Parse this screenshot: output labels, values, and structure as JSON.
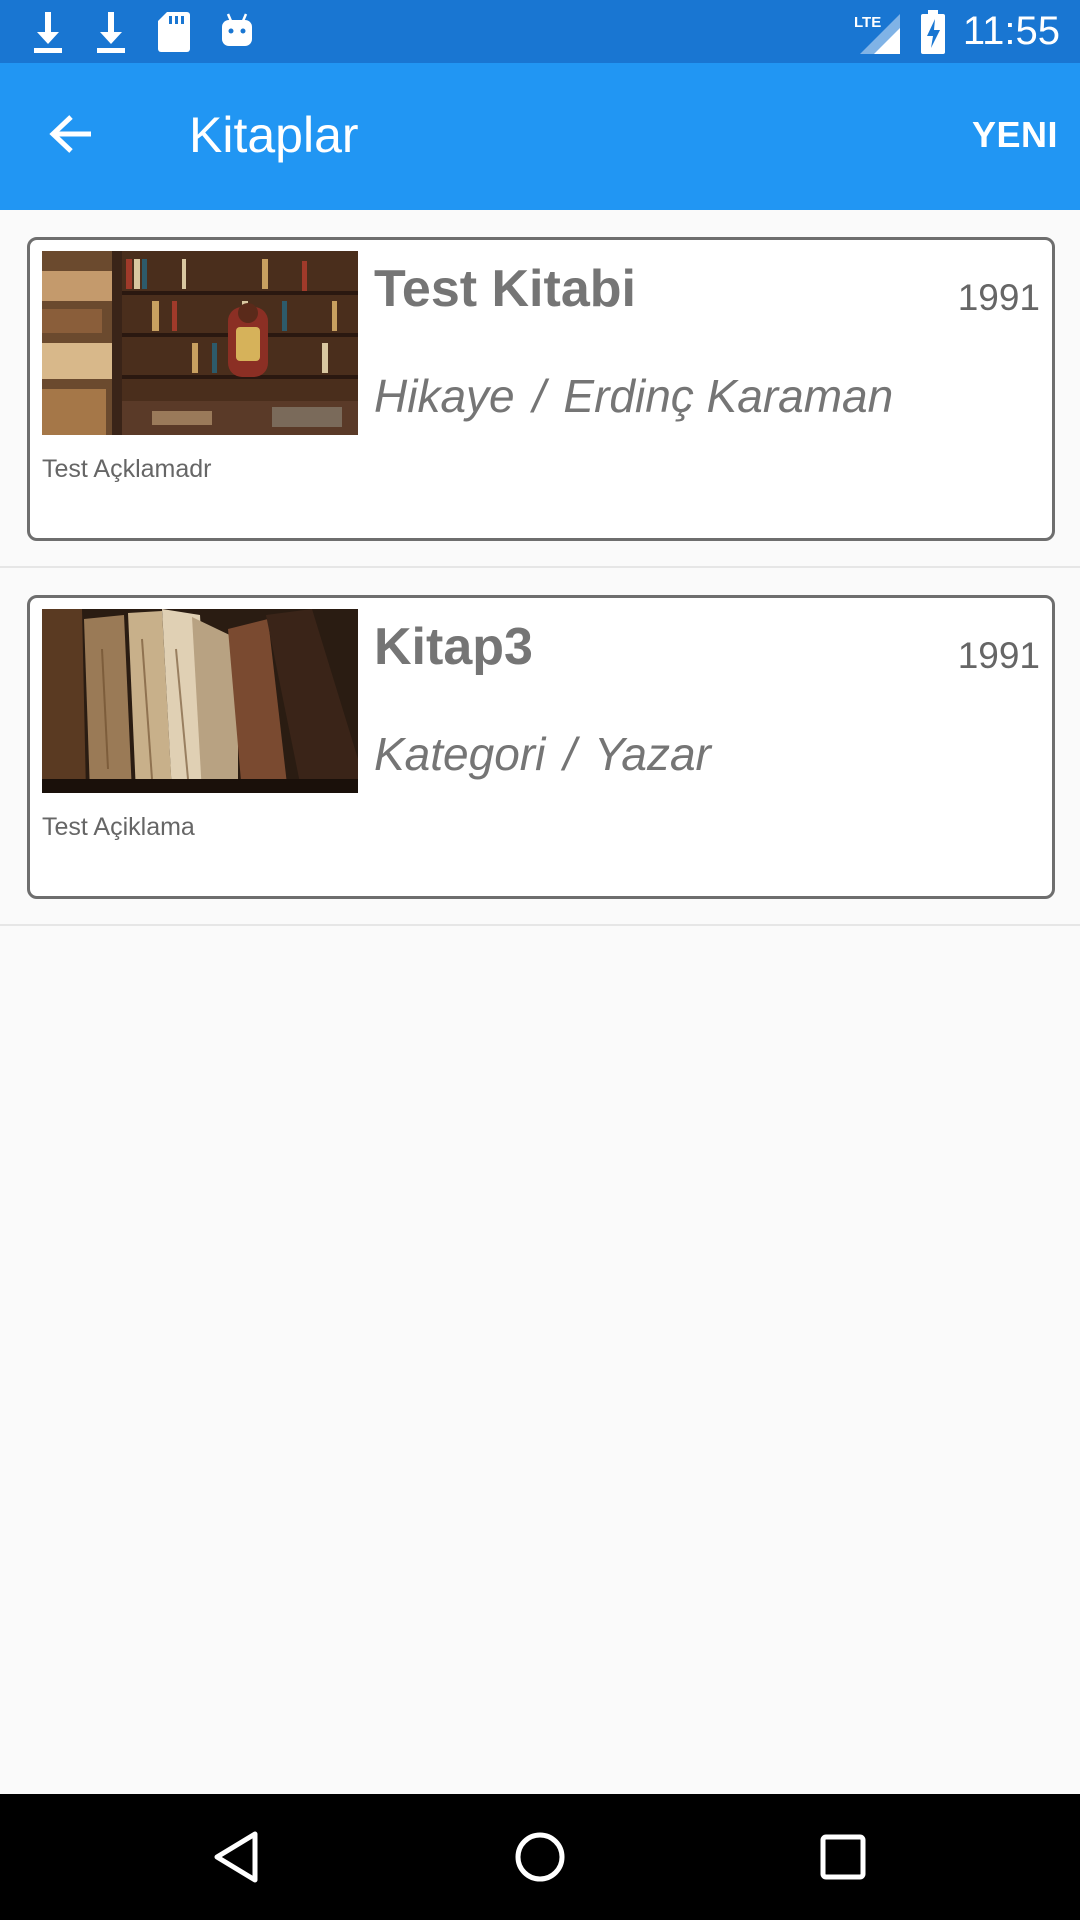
{
  "status_bar": {
    "icons": [
      "download-icon",
      "download-icon",
      "sd-card-icon",
      "android-icon",
      "lte-signal-icon",
      "battery-charging-icon"
    ],
    "network_label": "LTE",
    "time": "11:55"
  },
  "app_bar": {
    "back_icon": "arrow-back-icon",
    "title": "Kitaplar",
    "action_label": "YENI"
  },
  "books": [
    {
      "title": "Test Kitabi",
      "year": "1991",
      "category": "Hikaye",
      "separator": "/",
      "author": "Erdinç Karaman",
      "description": "Test Açklamadr",
      "image": "bookstore-photo"
    },
    {
      "title": "Kitap3",
      "year": "1991",
      "category": "Kategori",
      "separator": "/",
      "author": "Yazar",
      "description": "Test Açiklama",
      "image": "old-books-photo"
    }
  ],
  "nav_bar": {
    "icons": [
      "back-triangle-icon",
      "home-circle-icon",
      "recents-square-icon"
    ]
  },
  "colors": {
    "status_bar": "#1976d2",
    "app_bar": "#2196f3",
    "background": "#fafafa",
    "card_border": "#6e6e6e"
  }
}
